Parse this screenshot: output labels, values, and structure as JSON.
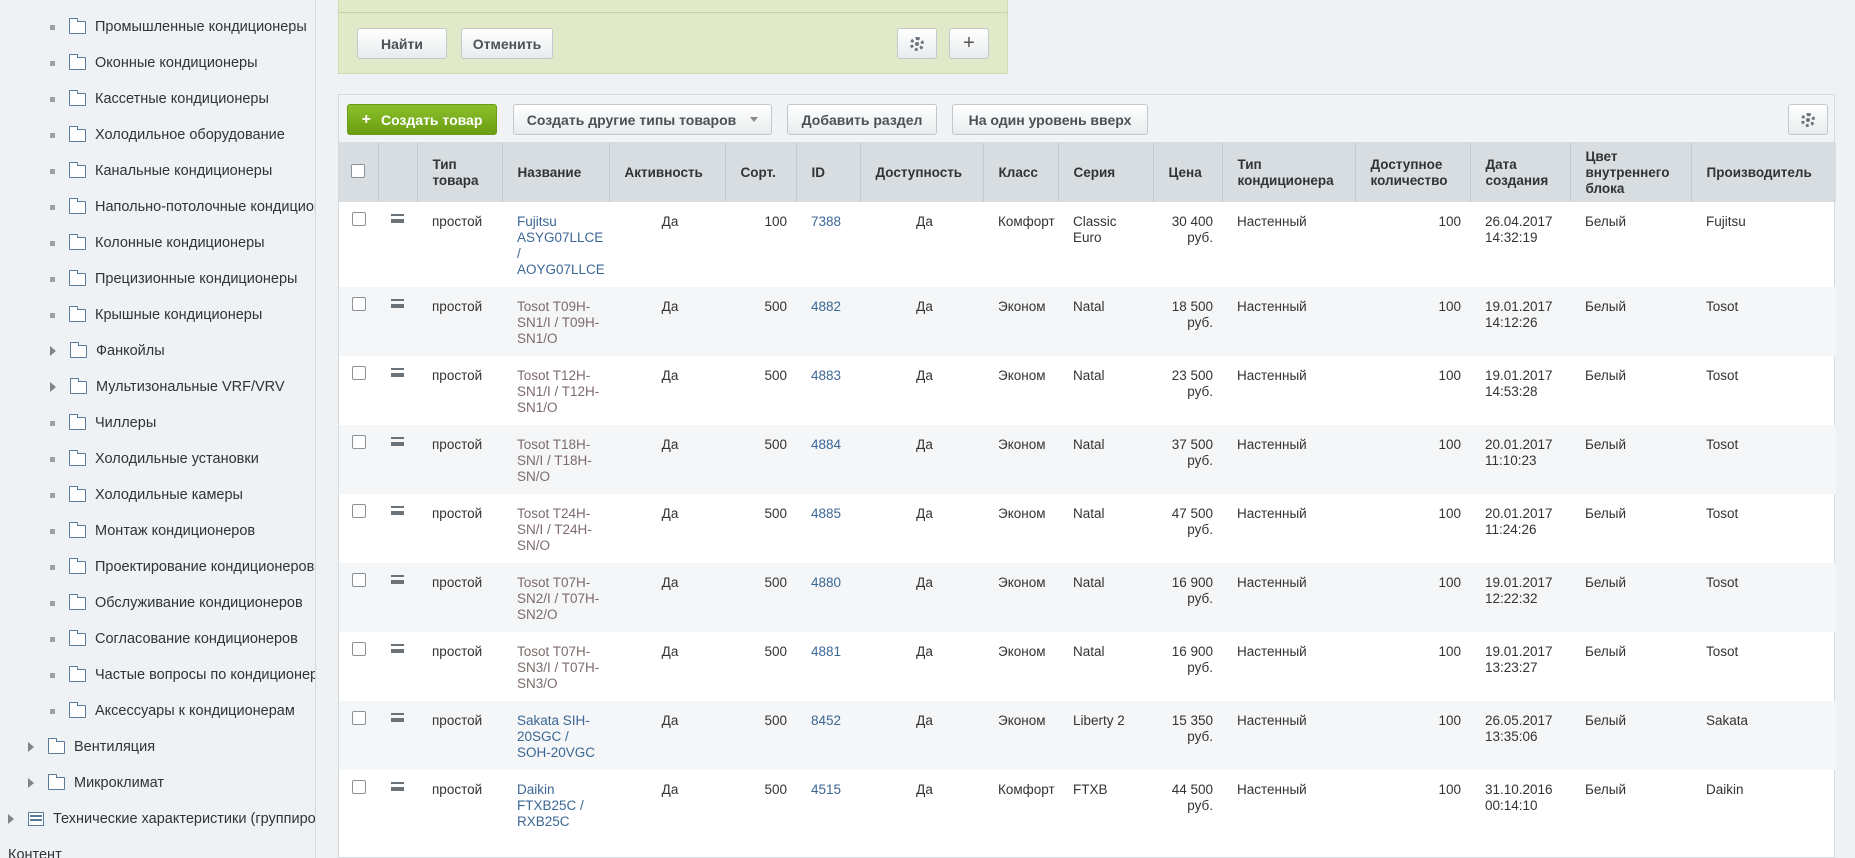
{
  "sidebar": {
    "items": [
      {
        "label": "Промышленные кондиционеры",
        "kind": "bullet",
        "icon": "folder-icon"
      },
      {
        "label": "Оконные кондиционеры",
        "kind": "bullet",
        "icon": "folder-icon"
      },
      {
        "label": "Кассетные кондиционеры",
        "kind": "bullet",
        "icon": "folder-icon"
      },
      {
        "label": "Холодильное оборудование",
        "kind": "bullet",
        "icon": "folder-icon"
      },
      {
        "label": "Канальные кондиционеры",
        "kind": "bullet",
        "icon": "folder-icon"
      },
      {
        "label": "Напольно-потолочные кондиционеры",
        "kind": "bullet",
        "icon": "folder-icon"
      },
      {
        "label": "Колонные кондиционеры",
        "kind": "bullet",
        "icon": "folder-icon"
      },
      {
        "label": "Прецизионные кондиционеры",
        "kind": "bullet",
        "icon": "folder-icon"
      },
      {
        "label": "Крышные кондиционеры",
        "kind": "bullet",
        "icon": "folder-icon"
      },
      {
        "label": "Фанкойлы",
        "kind": "arrow",
        "icon": "folder-icon"
      },
      {
        "label": "Мультизональные VRF/VRV",
        "kind": "arrow",
        "icon": "folder-icon"
      },
      {
        "label": "Чиллеры",
        "kind": "bullet",
        "icon": "folder-icon"
      },
      {
        "label": "Холодильные установки",
        "kind": "bullet",
        "icon": "folder-icon"
      },
      {
        "label": "Холодильные камеры",
        "kind": "bullet",
        "icon": "folder-icon"
      },
      {
        "label": "Монтаж кондиционеров",
        "kind": "bullet",
        "icon": "folder-icon"
      },
      {
        "label": "Проектирование кондиционеров",
        "kind": "bullet",
        "icon": "folder-icon"
      },
      {
        "label": "Обслуживание кондиционеров",
        "kind": "bullet",
        "icon": "folder-icon"
      },
      {
        "label": "Согласование кондиционеров",
        "kind": "bullet",
        "icon": "folder-icon"
      },
      {
        "label": "Частые вопросы по кондиционерам",
        "kind": "bullet",
        "icon": "folder-icon"
      },
      {
        "label": "Аксессуары к кондиционерам",
        "kind": "bullet",
        "icon": "folder-icon"
      },
      {
        "label": "Вентиляция",
        "kind": "arrow",
        "icon": "folder-icon"
      },
      {
        "label": "Микроклимат",
        "kind": "arrow",
        "icon": "folder-icon"
      },
      {
        "label": "Технические характеристики (группировка)",
        "kind": "arrow",
        "icon": "table-icon"
      },
      {
        "label": "Контент",
        "kind": "none",
        "icon": "none"
      }
    ]
  },
  "filter": {
    "find_label": "Найти",
    "cancel_label": "Отменить",
    "add_symbol": "+"
  },
  "toolbar": {
    "create_label": "Создать товар",
    "create_symbol": "+",
    "other_types_label": "Создать другие типы товаров",
    "add_section_label": "Добавить раздел",
    "level_up_label": "На один уровень вверх"
  },
  "table": {
    "headers": {
      "type": "Тип товара",
      "name": "Название",
      "active": "Активность",
      "sort": "Сорт.",
      "id": "ID",
      "availability": "Доступность",
      "class": "Класс",
      "series": "Серия",
      "price": "Цена",
      "ac_type": "Тип кондиционера",
      "qty": "Доступное количество",
      "created": "Дата создания",
      "color": "Цвет внутреннего блока",
      "maker": "Производитель"
    },
    "rows": [
      {
        "type": "простой",
        "name": "Fujitsu ASYG07LLCE / AOYG07LLCE",
        "active": "Да",
        "sort": "100",
        "id": "7388",
        "availability": "Да",
        "class": "Комфорт",
        "series": "Classic Euro",
        "price": "30 400 руб.",
        "ac_type": "Настенный",
        "qty": "100",
        "created": "26.04.2017 14:32:19",
        "color": "Белый",
        "maker": "Fujitsu"
      },
      {
        "type": "простой",
        "name": "Tosot T09H-SN1/I / T09H-SN1/O",
        "active": "Да",
        "sort": "500",
        "id": "4882",
        "availability": "Да",
        "class": "Эконом",
        "series": "Natal",
        "price": "18 500 руб.",
        "ac_type": "Настенный",
        "qty": "100",
        "created": "19.01.2017 14:12:26",
        "color": "Белый",
        "maker": "Tosot"
      },
      {
        "type": "простой",
        "name": "Tosot T12H-SN1/I / T12H-SN1/O",
        "active": "Да",
        "sort": "500",
        "id": "4883",
        "availability": "Да",
        "class": "Эконом",
        "series": "Natal",
        "price": "23 500 руб.",
        "ac_type": "Настенный",
        "qty": "100",
        "created": "19.01.2017 14:53:28",
        "color": "Белый",
        "maker": "Tosot"
      },
      {
        "type": "простой",
        "name": "Tosot T18H-SN/I / T18H-SN/O",
        "active": "Да",
        "sort": "500",
        "id": "4884",
        "availability": "Да",
        "class": "Эконом",
        "series": "Natal",
        "price": "37 500 руб.",
        "ac_type": "Настенный",
        "qty": "100",
        "created": "20.01.2017 11:10:23",
        "color": "Белый",
        "maker": "Tosot"
      },
      {
        "type": "простой",
        "name": "Tosot T24H-SN/I / T24H-SN/O",
        "active": "Да",
        "sort": "500",
        "id": "4885",
        "availability": "Да",
        "class": "Эконом",
        "series": "Natal",
        "price": "47 500 руб.",
        "ac_type": "Настенный",
        "qty": "100",
        "created": "20.01.2017 11:24:26",
        "color": "Белый",
        "maker": "Tosot"
      },
      {
        "type": "простой",
        "name": "Tosot T07H-SN2/I / T07H-SN2/O",
        "active": "Да",
        "sort": "500",
        "id": "4880",
        "availability": "Да",
        "class": "Эконом",
        "series": "Natal",
        "price": "16 900 руб.",
        "ac_type": "Настенный",
        "qty": "100",
        "created": "19.01.2017 12:22:32",
        "color": "Белый",
        "maker": "Tosot"
      },
      {
        "type": "простой",
        "name": "Tosot T07H-SN3/I / T07H-SN3/O",
        "active": "Да",
        "sort": "500",
        "id": "4881",
        "availability": "Да",
        "class": "Эконом",
        "series": "Natal",
        "price": "16 900 руб.",
        "ac_type": "Настенный",
        "qty": "100",
        "created": "19.01.2017 13:23:27",
        "color": "Белый",
        "maker": "Tosot"
      },
      {
        "type": "простой",
        "name": "Sakata SIH-20SGC / SOH-20VGC",
        "active": "Да",
        "sort": "500",
        "id": "8452",
        "availability": "Да",
        "class": "Эконом",
        "series": "Liberty 2",
        "price": "15 350 руб.",
        "ac_type": "Настенный",
        "qty": "100",
        "created": "26.05.2017 13:35:06",
        "color": "Белый",
        "maker": "Sakata"
      },
      {
        "type": "простой",
        "name": "Daikin FTXB25C / RXB25C",
        "active": "Да",
        "sort": "500",
        "id": "4515",
        "availability": "Да",
        "class": "Комфорт",
        "series": "FTXB",
        "price": "44 500 руб.",
        "ac_type": "Настенный",
        "qty": "100",
        "created": "31.10.2016 00:14:10",
        "color": "Белый",
        "maker": "Daikin"
      }
    ]
  }
}
